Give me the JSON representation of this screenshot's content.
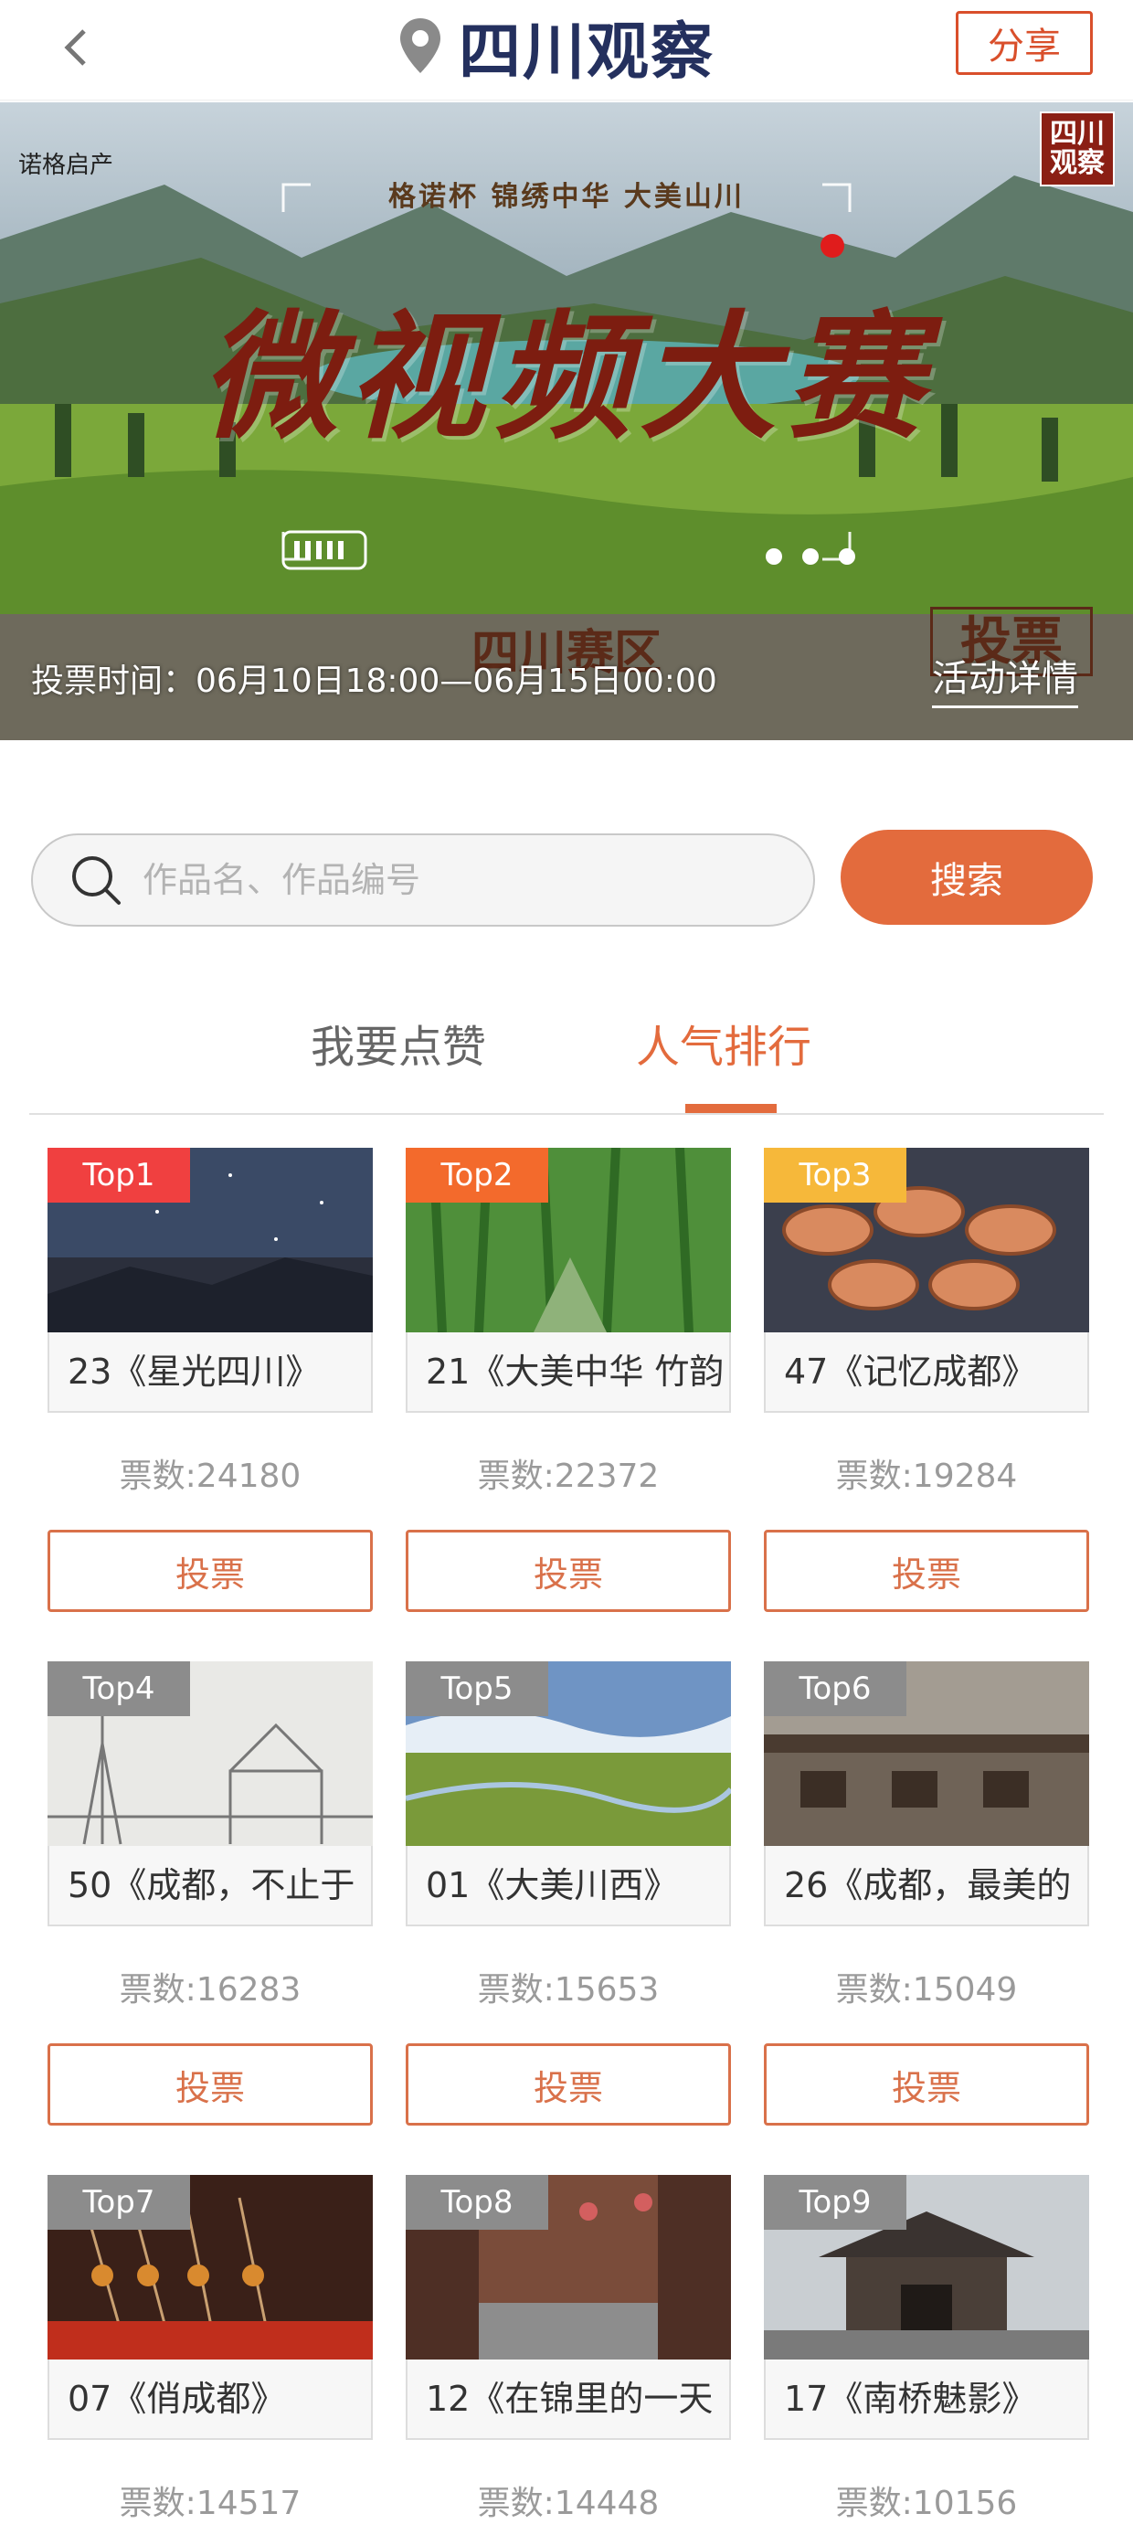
{
  "header": {
    "logo_text": "四川观察",
    "share_label": "分享"
  },
  "banner": {
    "subtitle": "格诺杯 锦绣中华 大美山川",
    "title": "微视频大赛",
    "region": "四川赛区",
    "brand_left": "诺格启产",
    "corner_logo": "四川观察",
    "stamp": "投票",
    "vote_time": "投票时间：06月10日18:00—06月15日00:00",
    "detail_link": "活动详情"
  },
  "search": {
    "placeholder": "作品名、作品编号",
    "button_label": "搜索"
  },
  "tabs": [
    {
      "label": "我要点赞",
      "active": false
    },
    {
      "label": "人气排行",
      "active": true
    }
  ],
  "colors": {
    "accent": "#e36b3d",
    "rank1": "#f04040",
    "rank2": "#f36a2c",
    "rank3": "#f6b83a",
    "rank_other": "#8c8c8c"
  },
  "vote_label": "投票",
  "items": [
    {
      "rank": "Top1",
      "title": "23《星光四川》",
      "votes": "票数:24180",
      "scene": "night"
    },
    {
      "rank": "Top2",
      "title": "21《大美中华 竹韵",
      "votes": "票数:22372",
      "scene": "bamboo"
    },
    {
      "rank": "Top3",
      "title": "47《记忆成都》",
      "votes": "票数:19284",
      "scene": "food"
    },
    {
      "rank": "Top4",
      "title": "50《成都，不止于",
      "votes": "票数:16283",
      "scene": "sketch"
    },
    {
      "rank": "Top5",
      "title": "01《大美川西》",
      "votes": "票数:15653",
      "scene": "grassland"
    },
    {
      "rank": "Top6",
      "title": "26《成都，最美的",
      "votes": "票数:15049",
      "scene": "street"
    },
    {
      "rank": "Top7",
      "title": "07《俏成都》",
      "votes": "票数:14517",
      "scene": "bbq"
    },
    {
      "rank": "Top8",
      "title": "12《在锦里的一天",
      "votes": "票数:14448",
      "scene": "market"
    },
    {
      "rank": "Top9",
      "title": "17《南桥魅影》",
      "votes": "票数:10156",
      "scene": "gate"
    }
  ]
}
